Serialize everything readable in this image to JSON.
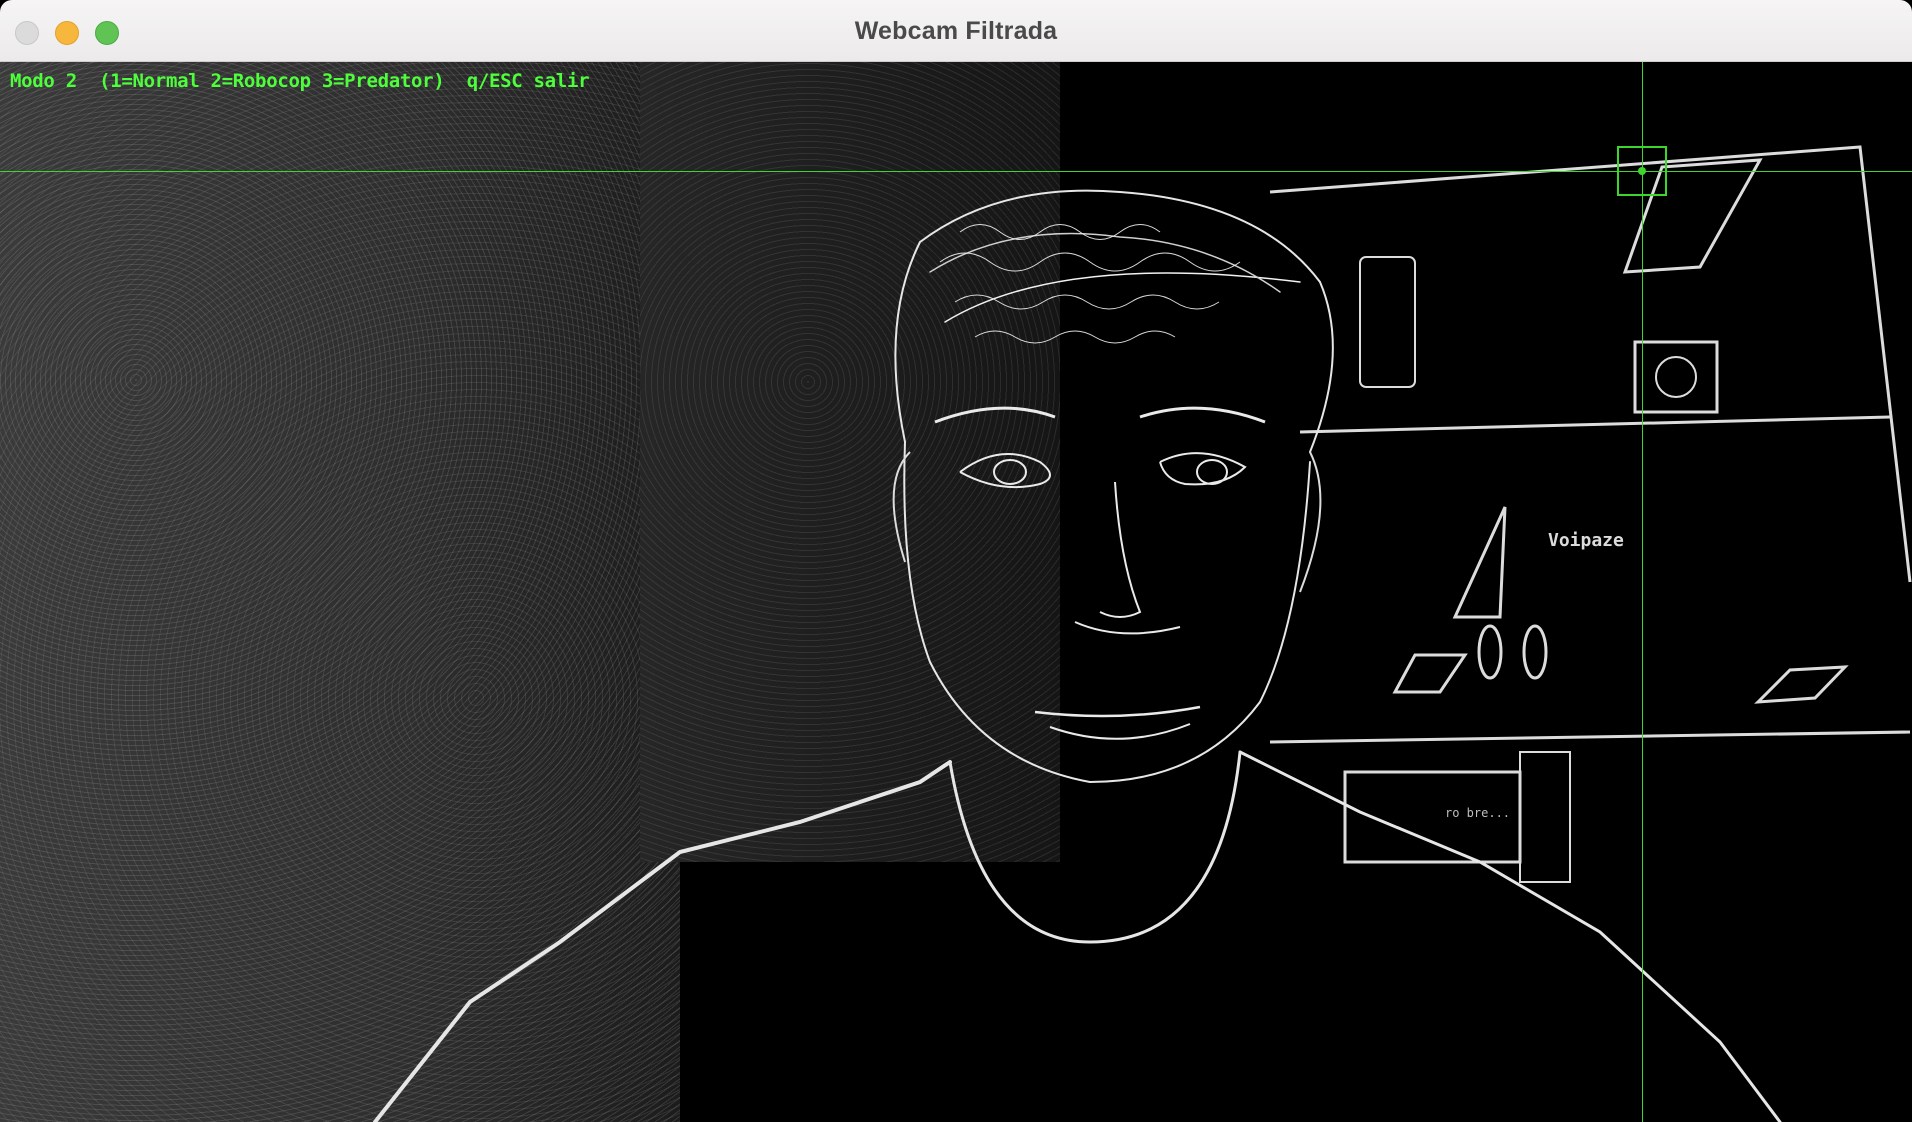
{
  "window": {
    "title": "Webcam Filtrada"
  },
  "overlay": {
    "status_text": "Modo 2  (1=Normal 2=Robocop 3=Predator)  q/ESC salir",
    "accent_color": "#3cd62c"
  },
  "scene": {
    "shelf_label": "Voipaze",
    "box_label": "ro bre..."
  },
  "icons": {
    "close": "close-window-icon",
    "minimize": "minimize-window-icon",
    "maximize": "maximize-window-icon"
  }
}
